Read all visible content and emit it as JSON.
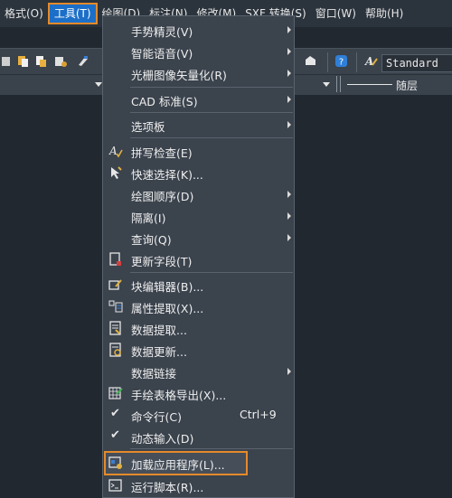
{
  "menubar": {
    "items": [
      {
        "label": "格式(O)"
      },
      {
        "label": "工具(T)",
        "active": true
      },
      {
        "label": "绘图(D)"
      },
      {
        "label": "标注(N)"
      },
      {
        "label": "修改(M)"
      },
      {
        "label": "SXF 转换(S)"
      },
      {
        "label": "窗口(W)"
      },
      {
        "label": "帮助(H)"
      }
    ]
  },
  "toolbar": {
    "text_style": "Standard",
    "layer": "随层"
  },
  "menu": {
    "items": [
      {
        "label": "手势精灵(V)",
        "submenu": true
      },
      {
        "label": "智能语音(V)",
        "submenu": true
      },
      {
        "label": "光栅图像矢量化(R)",
        "submenu": true
      },
      {
        "label": "CAD 标准(S)",
        "submenu": true
      },
      {
        "label": "选项板",
        "submenu": true
      },
      {
        "label": "拼写检查(E)",
        "icon": "spell-check-icon"
      },
      {
        "label": "快速选择(K)...",
        "icon": "quick-select-icon"
      },
      {
        "label": "绘图顺序(D)",
        "submenu": true
      },
      {
        "label": "隔离(I)",
        "submenu": true
      },
      {
        "label": "查询(Q)",
        "submenu": true
      },
      {
        "label": "更新字段(T)",
        "icon": "update-field-icon"
      },
      {
        "label": "块编辑器(B)...",
        "icon": "block-editor-icon"
      },
      {
        "label": "属性提取(X)...",
        "icon": "attribute-extract-icon"
      },
      {
        "label": "数据提取...",
        "icon": "data-extract-icon"
      },
      {
        "label": "数据更新...",
        "icon": "data-update-icon"
      },
      {
        "label": "数据链接",
        "submenu": true
      },
      {
        "label": "手绘表格导出(X)...",
        "icon": "table-export-icon"
      },
      {
        "label": "命令行(C)",
        "shortcut": "Ctrl+9",
        "checked": true
      },
      {
        "label": "动态输入(D)",
        "checked": true
      },
      {
        "label": "加载应用程序(L)...",
        "icon": "load-app-icon",
        "highlighted": true
      },
      {
        "label": "运行脚本(R)...",
        "icon": "run-script-icon"
      }
    ]
  },
  "colors": {
    "highlight_border": "#e58a2a",
    "active_menu": "#1c6fc8",
    "menu_bg": "#3b434d"
  }
}
